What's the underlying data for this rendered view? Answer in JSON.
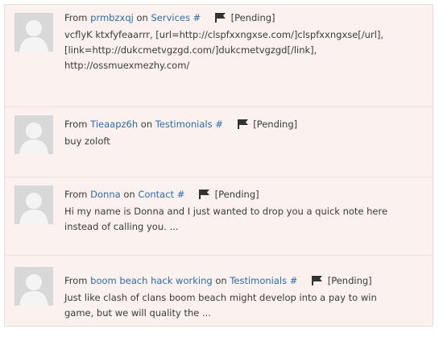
{
  "comments": [
    {
      "from_label": "From",
      "author": "prmbzxqj",
      "on_label": "on",
      "page": "Services",
      "hash": "#",
      "status": "[Pending]",
      "lines": [
        "vcflyK ktxfyfeaarrr, [url=http://clspfxxngxse.com/]clspfxxngxse[/url],",
        "[link=http://dukcmetvgzgd.com/]dukcmetvgzgd[/link],",
        "http://ossmuexmezhy.com/"
      ]
    },
    {
      "from_label": "From",
      "author": "Tieaapz6h",
      "on_label": "on",
      "page": "Testimonials",
      "hash": "#",
      "status": "[Pending]",
      "lines": [
        "buy zoloft"
      ]
    },
    {
      "from_label": "From",
      "author": "Donna",
      "on_label": "on",
      "page": "Contact",
      "hash": "#",
      "status": "[Pending]",
      "lines": [
        "Hi my name is Donna and I just wanted to drop you a quick note here",
        "instead of calling you. ..."
      ]
    },
    {
      "from_label": "From",
      "author": "boom beach hack working",
      "on_label": "on",
      "page": "Testimonials",
      "hash": "#",
      "status": "[Pending]",
      "lines": [
        "Just like clash of clans boom beach might develop into a pay to win",
        "game, but we will quality the ..."
      ]
    }
  ],
  "icons": {
    "avatar": "default-avatar-icon",
    "flag": "flag-icon"
  },
  "colors": {
    "link": "#2c6ca8",
    "row_background": "#fbf2f0",
    "avatar_bg": "#d9d9d9"
  }
}
